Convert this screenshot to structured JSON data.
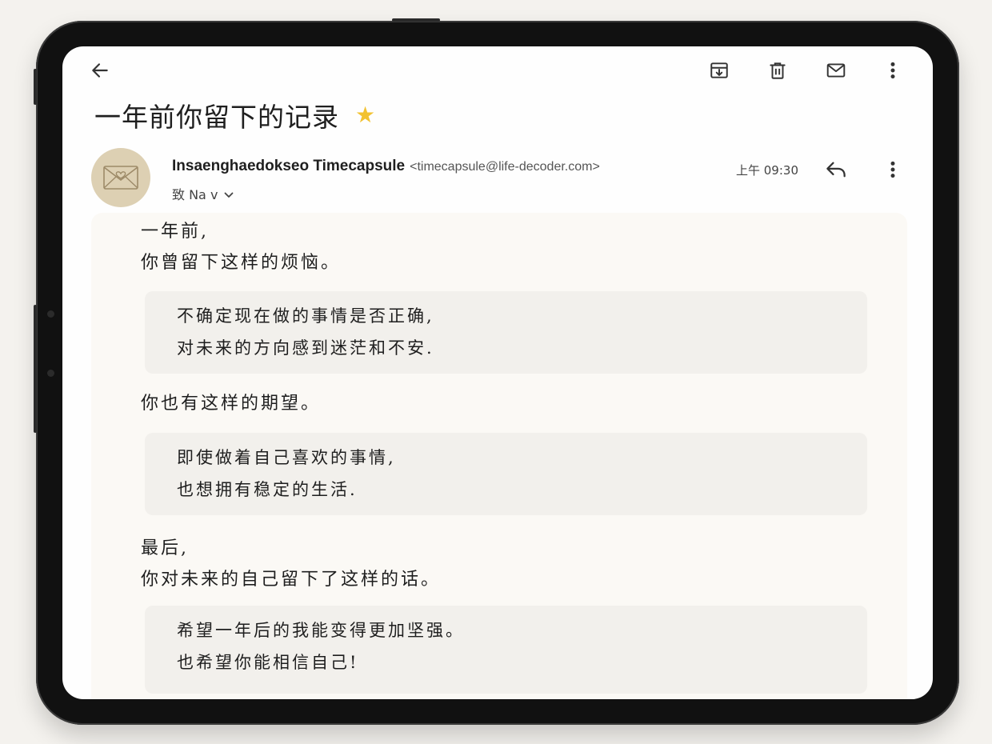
{
  "email": {
    "subject": "一年前你留下的记录",
    "starred": true,
    "sender": {
      "name": "Insaenghaedokseo Timecapsule",
      "email": "<timecapsule@life-decoder.com>"
    },
    "recipient_label": "致 Na v",
    "time": "上午 09:30"
  },
  "toolbar": {
    "icons": [
      "back-arrow-icon",
      "archive-icon",
      "delete-icon",
      "mail-icon",
      "more-vert-icon"
    ]
  },
  "message": {
    "intro": [
      "一年前,",
      "你曾留下这样的烦恼。"
    ],
    "worry": [
      "不确定现在做的事情是否正确,",
      "对未来的方向感到迷茫和不安."
    ],
    "hope_intro": "你也有这样的期望。",
    "hope": [
      "即使做着自己喜欢的事情,",
      "也想拥有稳定的生活."
    ],
    "final_intro": [
      "最后,",
      "你对未来的自己留下了这样的话。"
    ],
    "final": [
      "希望一年后的我能变得更加坚强。",
      "也希望你能相信自己!"
    ]
  },
  "colors": {
    "star": "#f2c230",
    "avatar_bg": "#ddd0b3",
    "quote_bg": "#f2f0ec",
    "page_bg": "#fbf9f5"
  }
}
